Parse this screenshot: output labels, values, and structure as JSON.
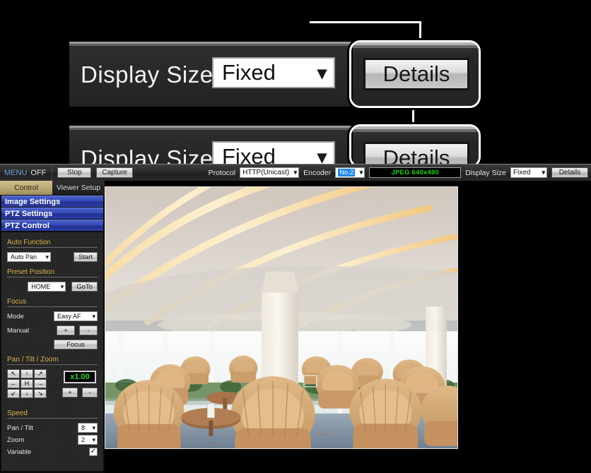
{
  "callout": {
    "display_size_label": "Display Size",
    "display_size_value": "Fixed",
    "dropdown_arrow": "chevron-down-icon",
    "details_label": "Details"
  },
  "callout2": {
    "display_size_label": "Display Size",
    "display_size_value": "Fixed",
    "details_label": "Details"
  },
  "toolbar": {
    "menu_label": "MENU",
    "menu_state": "OFF",
    "stop_label": "Stop",
    "capture_label": "Capture",
    "protocol_label": "Protocol",
    "protocol_value": "HTTP(Unicast)",
    "encoder_label": "Encoder",
    "encoder_value": "No.2",
    "stream_status": "JPEG 640x480",
    "display_size_label": "Display Size",
    "display_size_value": "Fixed",
    "details_label": "Details"
  },
  "sidebar": {
    "tabs": [
      {
        "label": "Control",
        "active": true
      },
      {
        "label": "Viewer Setup",
        "active": false
      }
    ],
    "nav_items": [
      {
        "label": "Image Settings"
      },
      {
        "label": "PTZ Settings"
      },
      {
        "label": "PTZ Control"
      }
    ],
    "auto_function": {
      "heading": "Auto Function",
      "mode_value": "Auto Pan",
      "start_label": "Start"
    },
    "preset_position": {
      "heading": "Preset Position",
      "preset_value": "HOME",
      "goto_label": "GoTo"
    },
    "focus": {
      "heading": "Focus",
      "mode_label": "Mode",
      "mode_value": "Easy AF",
      "manual_label": "Manual",
      "plus_label": "+",
      "minus_label": "-",
      "focus_label": "Focus"
    },
    "ptz": {
      "heading": "Pan / Tilt / Zoom",
      "pad": [
        "↖",
        "↑",
        "↗",
        "←",
        "H",
        "→",
        "↙",
        "↓",
        "↘"
      ],
      "zoom_value": "x1.00",
      "zoom_in_label": "+",
      "zoom_out_label": "-"
    },
    "speed": {
      "heading": "Speed",
      "pan_tilt_label": "Pan / Tilt",
      "pan_tilt_value": "8",
      "zoom_label": "Zoom",
      "zoom_value": "2",
      "variable_label": "Variable",
      "variable_checked": "✓"
    }
  },
  "colors": {
    "accent_blue": "#3247b4",
    "tab_active": "#b7a673",
    "section_heading": "#d7b24a",
    "stream_green": "#19d419",
    "encoder_highlight": "#1c86ee"
  }
}
